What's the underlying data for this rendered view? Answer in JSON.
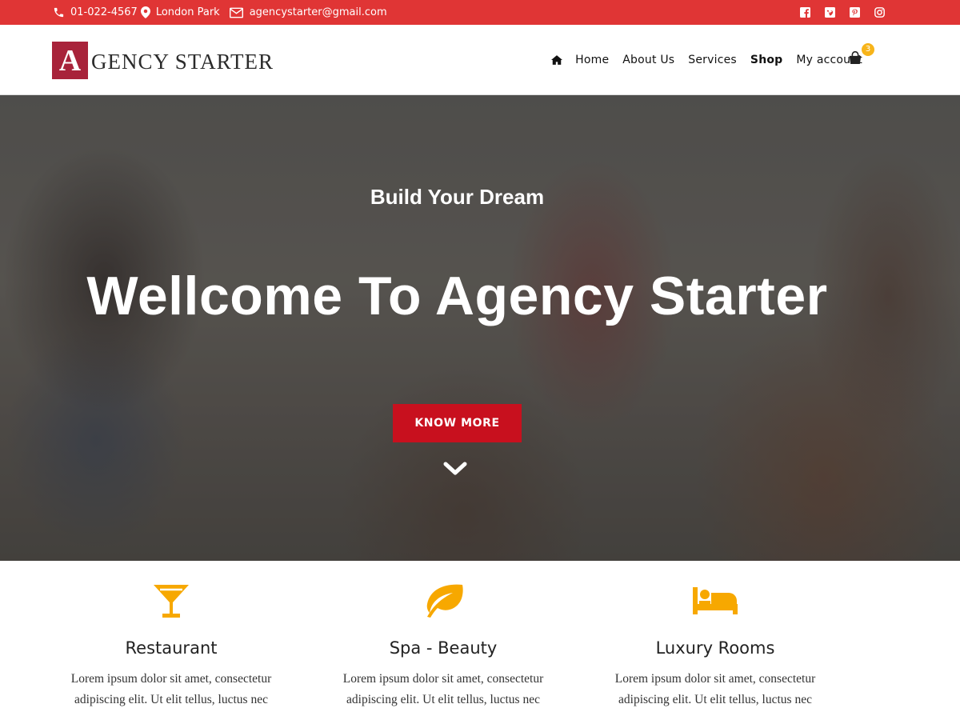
{
  "topbar": {
    "phone": "01-022-4567",
    "location": "London Park",
    "email": "agencystarter@gmail.com",
    "social": [
      "facebook-icon",
      "vimeo-icon",
      "pinterest-icon",
      "instagram-icon"
    ],
    "color": "#e03535"
  },
  "header": {
    "logo_letter": "A",
    "logo_text": "GENCY STARTER",
    "nav": [
      {
        "label": "Home"
      },
      {
        "label": "About Us"
      },
      {
        "label": "Services"
      },
      {
        "label": "Shop",
        "active": true
      },
      {
        "label": "My account"
      }
    ],
    "cart_count": "3"
  },
  "hero": {
    "subtitle": "Build Your Dream",
    "title": "Wellcome To Agency Starter",
    "cta_label": "KNOW MORE",
    "cta_color": "#c8101e"
  },
  "features": [
    {
      "icon": "cocktail-icon",
      "name": "Restaurant",
      "desc_line1": "Lorem ipsum dolor sit amet, consectetur",
      "desc_line2": "adipiscing elit. Ut elit tellus, luctus nec"
    },
    {
      "icon": "leaf-icon",
      "name": "Spa - Beauty",
      "desc_line1": "Lorem ipsum dolor sit amet, consectetur",
      "desc_line2": "adipiscing elit. Ut elit tellus, luctus nec"
    },
    {
      "icon": "bed-icon",
      "name": "Luxury Rooms",
      "desc_line1": "Lorem ipsum dolor sit amet, consectetur",
      "desc_line2": "adipiscing elit. Ut elit tellus, luctus nec"
    }
  ],
  "accent_color": "#f7a800"
}
